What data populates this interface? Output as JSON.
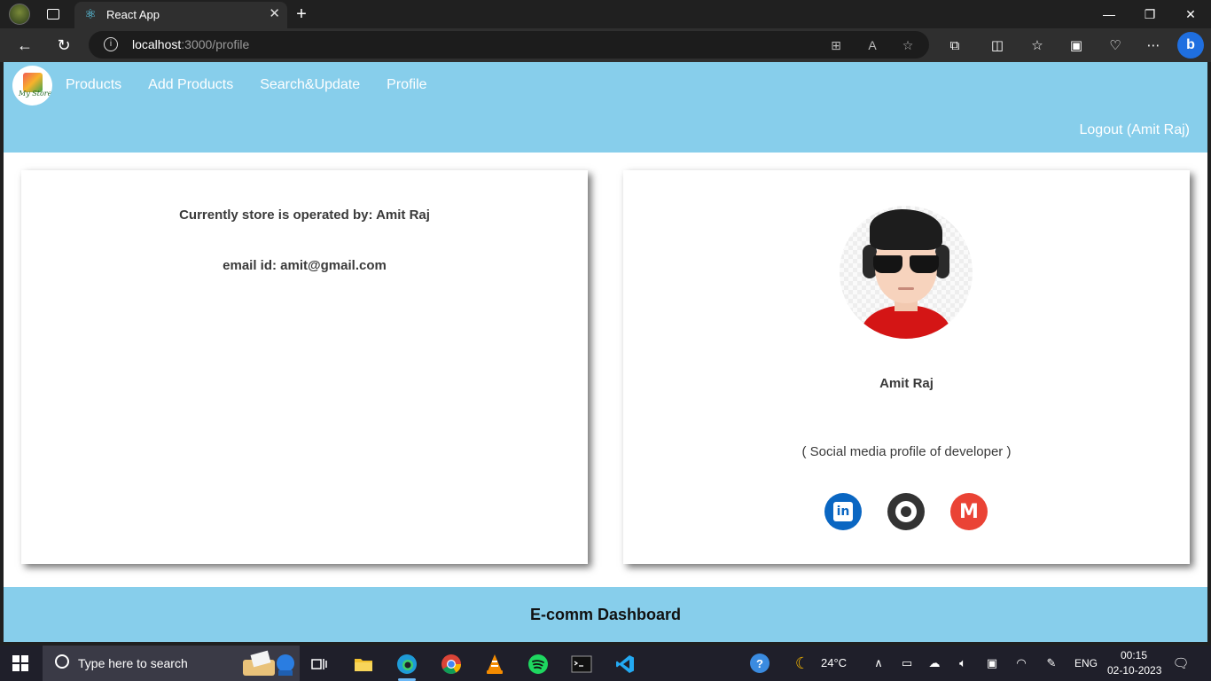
{
  "browser": {
    "tab_title": "React App",
    "url_host": "localhost",
    "url_path": ":3000/profile"
  },
  "header": {
    "nav": [
      "Products",
      "Add Products",
      "Search&Update",
      "Profile"
    ],
    "logo_text": "My Store",
    "logout": "Logout (Amit Raj)"
  },
  "left_card": {
    "operator": "Currently store is operated by: Amit Raj",
    "email": "email id: amit@gmail.com"
  },
  "right_card": {
    "name": "Amit Raj",
    "note": "( Social media profile of developer )",
    "social": [
      "linkedin-icon",
      "github-icon",
      "gmail-icon"
    ]
  },
  "footer": {
    "title": "E-comm Dashboard"
  },
  "taskbar": {
    "search_placeholder": "Type here to search",
    "weather": "24°C",
    "language": "ENG",
    "time": "00:15",
    "date": "02-10-2023"
  },
  "colors": {
    "header_bg": "#87ceeb",
    "footer_bg": "#87ceeb",
    "linkedin": "#0a66c2",
    "github": "#333333",
    "gmail": "#ea4335"
  }
}
